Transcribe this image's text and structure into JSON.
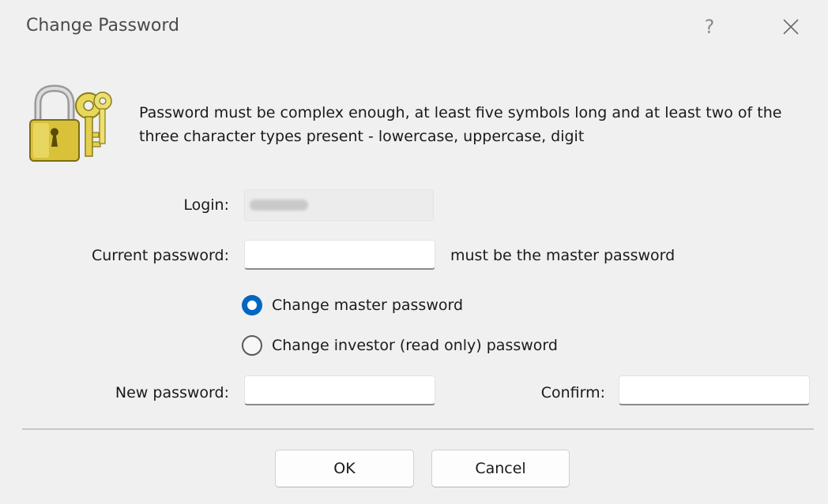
{
  "window": {
    "title": "Change Password",
    "help_glyph": "?",
    "close_icon": "close-icon"
  },
  "message": "Password must be complex enough, at least five symbols long and at least two of the three character types present - lowercase, uppercase, digit",
  "icons": {
    "dialog_icon": "lock-and-keys-icon"
  },
  "form": {
    "login_label": "Login:",
    "login_value": "",
    "current_password_label": "Current password:",
    "current_password_value": "",
    "current_password_hint": "must be the master password",
    "options": [
      {
        "label": "Change master password",
        "checked": true
      },
      {
        "label": "Change investor (read only) password",
        "checked": false
      }
    ],
    "new_password_label": "New password:",
    "new_password_value": "",
    "confirm_label": "Confirm:",
    "confirm_value": ""
  },
  "buttons": {
    "ok": "OK",
    "cancel": "Cancel"
  },
  "colors": {
    "accent": "#0067c0",
    "background": "#f0f0f0",
    "lock_gold": "#d9c23a"
  }
}
